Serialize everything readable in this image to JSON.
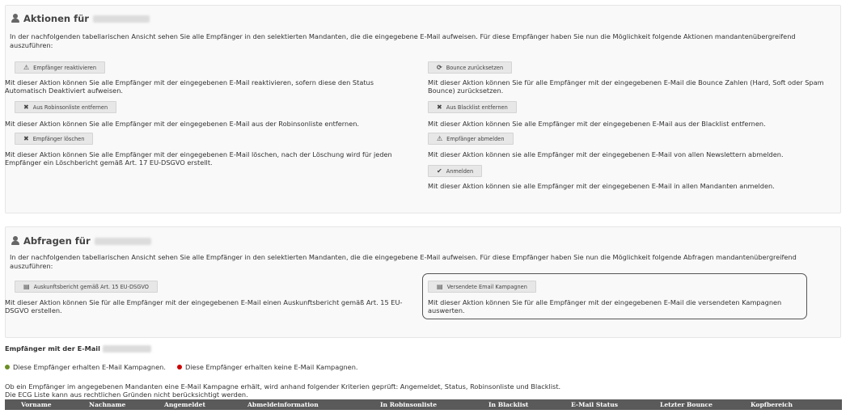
{
  "actions": {
    "title": "Aktionen für",
    "intro": "In der nachfolgenden tabellarischen Ansicht sehen Sie alle Empfänger in den selektierten Mandanten, die die eingegebene E-Mail aufweisen. Für diese Empfänger haben Sie nun die Möglichkeit folgende Aktionen mandantenübergreifend auszuführen:",
    "reactivate": {
      "label": "Empfänger reaktivieren",
      "icon": "warning-icon",
      "desc": "Mit dieser Aktion können Sie alle Empfänger mit der eingegebenen E-Mail reaktivieren, sofern diese den Status Automatisch Deaktiviert aufweisen."
    },
    "robinson": {
      "label": "Aus Robinsonliste entfernen",
      "icon": "x-icon",
      "desc": "Mit dieser Aktion können Sie alle Empfänger mit der eingegebenen E-Mail aus der Robinsonliste entfernen."
    },
    "delete": {
      "label": "Empfänger löschen",
      "icon": "x-icon",
      "desc": "Mit dieser Aktion können Sie alle Empfänger mit der eingegebenen E-Mail löschen, nach der Löschung wird für jeden Empfänger ein Löschbericht gemäß Art. 17 EU-DSGVO erstellt."
    },
    "bounce": {
      "label": "Bounce zurücksetzen",
      "icon": "refresh-icon",
      "desc": "Mit dieser Aktion können Sie für alle Empfänger mit der eingegebenen E-Mail die Bounce Zahlen (Hard, Soft oder Spam Bounce) zurücksetzen."
    },
    "blacklist": {
      "label": "Aus Blacklist entfernen",
      "icon": "x-icon",
      "desc": "Mit dieser Aktion können Sie alle Empfänger mit der eingegebenen E-Mail aus der Blacklist entfernen."
    },
    "unsubscribe": {
      "label": "Empfänger abmelden",
      "icon": "warning-icon",
      "desc": "Mit dieser Aktion können sie alle Empfänger mit der eingegebenen E-Mail von allen Newslettern abmelden."
    },
    "subscribe": {
      "label": "Anmelden",
      "icon": "check-icon",
      "desc": "Mit dieser Aktion können sie alle Empfänger mit der eingegebenen E-Mail in allen Mandanten anmelden."
    }
  },
  "queries": {
    "title": "Abfragen für",
    "intro": "In der nachfolgenden tabellarischen Ansicht sehen Sie alle Empfänger in den selektierten Mandanten, die die eingegebene E-Mail aufweisen. Für diese Empfänger haben Sie nun die Möglichkeit folgende Abfragen mandantenübergreifend auszuführen:",
    "report": {
      "label": "Auskunftsbericht gemäß Art. 15 EU-DSGVO",
      "icon": "document-icon",
      "desc": "Mit dieser Aktion können Sie für alle Empfänger mit der eingegebenen E-Mail einen Auskunftsbericht gemäß Art. 15 EU-DSGVO erstellen."
    },
    "campaigns": {
      "label": "Versendete Email Kampagnen",
      "icon": "document-icon",
      "desc": "Mit dieser Aktion können Sie für alle Empfänger mit der eingegebenen E-Mail die versendeten Kampagnen auswerten."
    }
  },
  "recipients": {
    "title": "Empfänger mit der E-Mail",
    "legend_green": "Diese Empfänger erhalten E-Mail Kampagnen.",
    "legend_red": "Diese Empfänger erhalten keine E-Mail Kampagnen.",
    "criteria_1": "Ob ein Empfänger im angegebenen Mandanten eine E-Mail Kampagne erhält, wird anhand folgender Kriterien geprüft: Angemeldet, Status, Robinsonliste und Blacklist.",
    "criteria_2": "Die ECG Liste kann aus rechtlichen Gründen nicht berücksichtigt werden.",
    "columns": [
      "Vorname",
      "Nachname",
      "Angemeldet",
      "Abmeldeinformation",
      "In Robinsonliste",
      "In Blacklist",
      "E-Mail Status",
      "Letzter Bounce",
      "Kopfbereich"
    ]
  },
  "colors": {
    "green": "#6b8e23",
    "red": "#cc0000",
    "header_bg": "#5a5a5a"
  }
}
